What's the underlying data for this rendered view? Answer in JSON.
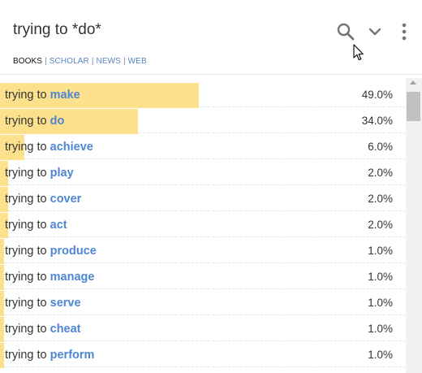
{
  "header": {
    "query": "trying to *do*",
    "sources": [
      {
        "label": "BOOKS",
        "active": true
      },
      {
        "label": "SCHOLAR",
        "active": false
      },
      {
        "label": "NEWS",
        "active": false
      },
      {
        "label": "WEB",
        "active": false
      }
    ],
    "icons": [
      "search-icon",
      "chevron-down-icon",
      "more-vert-icon"
    ]
  },
  "results": [
    {
      "prefix": "trying to",
      "term": "make",
      "percent_label": "49.0%",
      "share": 0.49
    },
    {
      "prefix": "trying to",
      "term": "do",
      "percent_label": "34.0%",
      "share": 0.34
    },
    {
      "prefix": "trying to",
      "term": "achieve",
      "percent_label": "6.0%",
      "share": 0.06
    },
    {
      "prefix": "trying to",
      "term": "play",
      "percent_label": "2.0%",
      "share": 0.02
    },
    {
      "prefix": "trying to",
      "term": "cover",
      "percent_label": "2.0%",
      "share": 0.02
    },
    {
      "prefix": "trying to",
      "term": "act",
      "percent_label": "2.0%",
      "share": 0.02
    },
    {
      "prefix": "trying to",
      "term": "produce",
      "percent_label": "1.0%",
      "share": 0.01
    },
    {
      "prefix": "trying to",
      "term": "manage",
      "percent_label": "1.0%",
      "share": 0.01
    },
    {
      "prefix": "trying to",
      "term": "serve",
      "percent_label": "1.0%",
      "share": 0.01
    },
    {
      "prefix": "trying to",
      "term": "cheat",
      "percent_label": "1.0%",
      "share": 0.01
    },
    {
      "prefix": "trying to",
      "term": "perform",
      "percent_label": "1.0%",
      "share": 0.01
    }
  ],
  "colors": {
    "bar": "#fde08c",
    "term_link": "#4d86d4",
    "source_link": "#5a83c4",
    "text": "#333333"
  }
}
